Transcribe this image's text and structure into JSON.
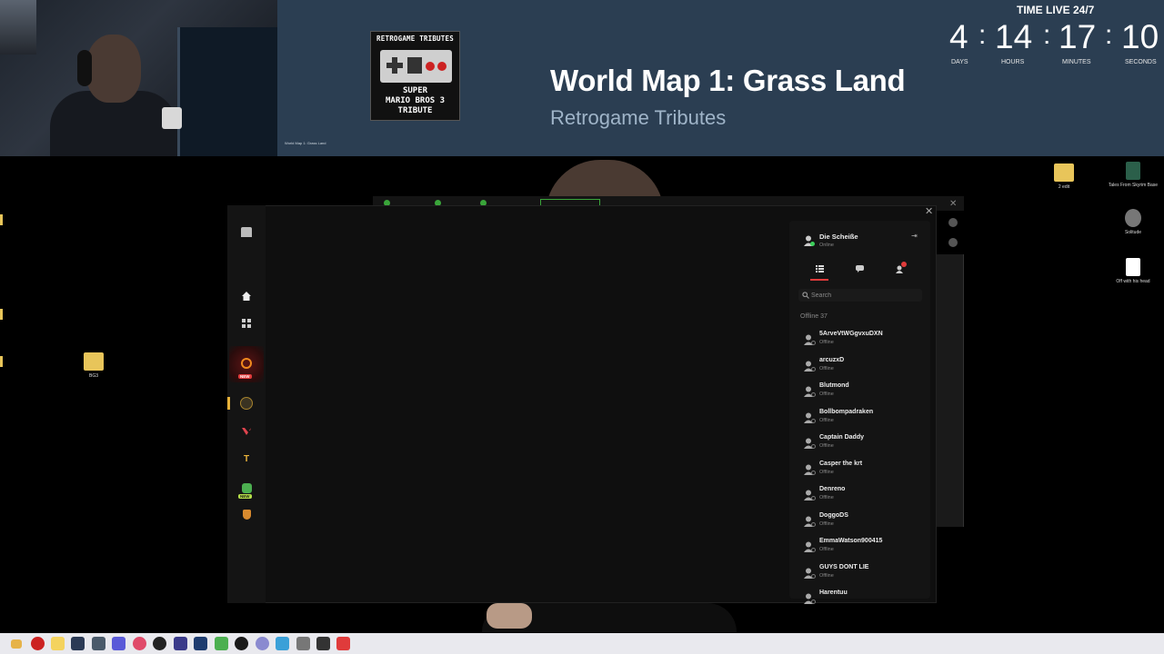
{
  "overlay": {
    "album_art": {
      "header": "RETROGAME TRIBUTES",
      "title_lines": [
        "SUPER",
        "MARIO BROS 3",
        "TRIBUTE"
      ]
    },
    "mini_caption": "World Map 1: Grass Land",
    "song_title": "World Map 1: Grass Land",
    "song_artist": "Retrogame Tributes",
    "timer": {
      "title": "TIME LIVE 24/7",
      "days": "4",
      "hours": "14",
      "minutes": "17",
      "seconds": "10",
      "labels": {
        "days": "DAYS",
        "hours": "HOURS",
        "minutes": "MINUTES",
        "seconds": "SECONDS"
      },
      "separator": ":"
    },
    "colors": {
      "panel": "#2b3e52",
      "artist": "#9fb4c8"
    }
  },
  "desktop": {
    "left_icons": [
      {
        "label": "BG3"
      }
    ],
    "right_icons": [
      {
        "label": "2 edit"
      },
      {
        "label": "Tales From Skyrim Base"
      },
      {
        "label": "Solitude"
      },
      {
        "label": "Off with his head"
      }
    ]
  },
  "launcher": {
    "sidebar_icons": [
      "logo-icon",
      "home-icon",
      "library-icon",
      "game-icon-orange",
      "game-icon-gold",
      "game-icon-valorant",
      "game-icon-tft",
      "game-icon-green",
      "game-icon-shield"
    ],
    "badge_new": "NEW",
    "accent": "#e03b3b",
    "friends": {
      "user": {
        "name": "Die Scheiße",
        "status": "Online"
      },
      "search_placeholder": "Search",
      "section_label": "Offline",
      "section_count": "37",
      "list": [
        {
          "name": "5ArveVtWGgvxuDXN",
          "status": "Offline"
        },
        {
          "name": "arcuzxD",
          "status": "Offline"
        },
        {
          "name": "Blutmond",
          "status": "Offline"
        },
        {
          "name": "Bollbompadraken",
          "status": "Offline"
        },
        {
          "name": "Captain Daddy",
          "status": "Offline"
        },
        {
          "name": "Casper the krt",
          "status": "Offline"
        },
        {
          "name": "Denreno",
          "status": "Offline"
        },
        {
          "name": "DoggoDS",
          "status": "Offline"
        },
        {
          "name": "EmmaWatson900415",
          "status": "Offline"
        },
        {
          "name": "GUYS DONT LIE",
          "status": "Offline"
        },
        {
          "name": "Harentuu",
          "status": ""
        }
      ]
    }
  }
}
